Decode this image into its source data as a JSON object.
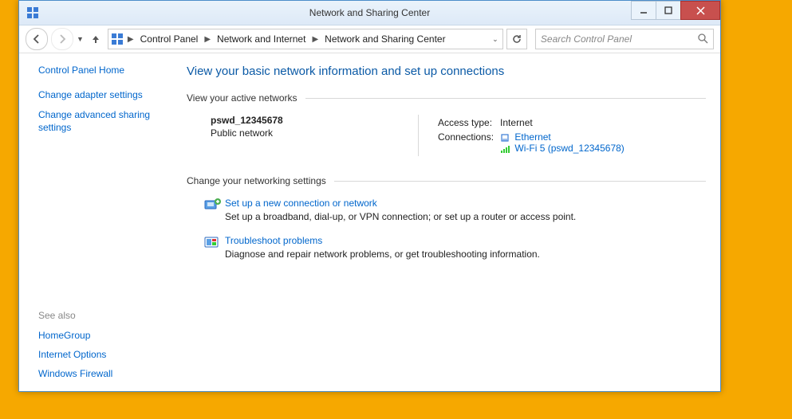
{
  "window": {
    "title": "Network and Sharing Center"
  },
  "breadcrumb": {
    "item1": "Control Panel",
    "item2": "Network and Internet",
    "item3": "Network and Sharing Center"
  },
  "search": {
    "placeholder": "Search Control Panel"
  },
  "sidebar": {
    "home": "Control Panel Home",
    "link1": "Change adapter settings",
    "link2": "Change advanced sharing settings",
    "seealso_head": "See also",
    "see1": "HomeGroup",
    "see2": "Internet Options",
    "see3": "Windows Firewall"
  },
  "main": {
    "heading": "View your basic network information and set up connections",
    "active_label": "View your active networks",
    "network_name": "pswd_12345678",
    "network_kind": "Public network",
    "access_label": "Access type:",
    "access_value": "Internet",
    "conn_label": "Connections:",
    "conn1": "Ethernet",
    "conn2": "Wi-Fi 5 (pswd_12345678)",
    "change_label": "Change your networking settings",
    "task1_title": "Set up a new connection or network",
    "task1_desc": "Set up a broadband, dial-up, or VPN connection; or set up a router or access point.",
    "task2_title": "Troubleshoot problems",
    "task2_desc": "Diagnose and repair network problems, or get troubleshooting information."
  }
}
